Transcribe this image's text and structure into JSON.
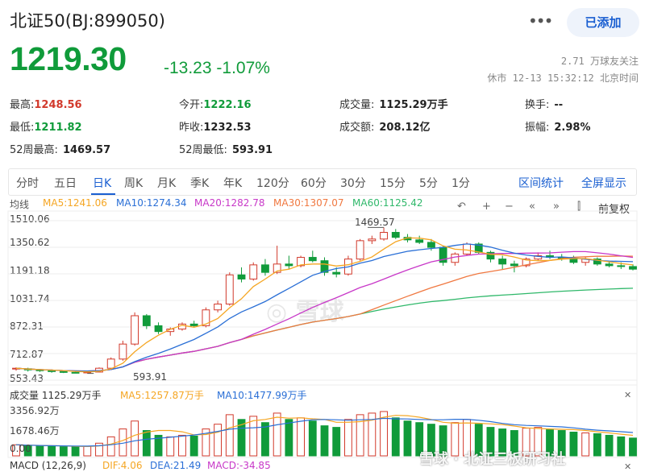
{
  "header": {
    "title": "北证50(BJ:899050)",
    "more_icon": "ellipsis-icon",
    "add_button": "已添加"
  },
  "quote": {
    "price": "1219.30",
    "change": "-13.23",
    "change_pct": "-1.07%",
    "followers": "2.71 万球友关注",
    "status": "休市 12-13 15:32:12 北京时间"
  },
  "stats": {
    "high_label": "最高:",
    "high": "1248.56",
    "low_label": "最低:",
    "low": "1211.82",
    "w52high_label": "52周最高:",
    "w52high": "1469.57",
    "open_label": "今开:",
    "open": "1222.16",
    "prevclose_label": "昨收:",
    "prevclose": "1232.53",
    "w52low_label": "52周最低:",
    "w52low": "593.91",
    "volume_label": "成交量:",
    "volume": "1125.29万手",
    "amount_label": "成交额:",
    "amount": "208.12亿",
    "turnover_label": "换手:",
    "turnover": "--",
    "amplitude_label": "振幅:",
    "amplitude": "2.98%"
  },
  "tabs": [
    "分时",
    "五日",
    "日K",
    "周K",
    "月K",
    "季K",
    "年K",
    "120分",
    "60分",
    "30分",
    "15分",
    "5分",
    "1分"
  ],
  "active_tab": "日K",
  "right_tabs": [
    "区间统计",
    "全屏显示"
  ],
  "ma_legend": {
    "label": "均线",
    "ma5": "MA5:1241.06",
    "ma10": "MA10:1274.34",
    "ma20": "MA20:1282.78",
    "ma30": "MA30:1307.07",
    "ma60": "MA60:1125.42"
  },
  "toolbar": {
    "icons": [
      "undo-icon",
      "zoom-in-icon",
      "zoom-out-icon",
      "scroll-left-icon",
      "scroll-right-icon",
      "candle-settings-icon"
    ],
    "adjust_label": "前复权"
  },
  "y_axis": [
    "1510.06",
    "1350.62",
    "1191.18",
    "1031.74",
    "872.31",
    "712.87",
    "553.43"
  ],
  "annotations": {
    "high_mark": "1469.57",
    "low_mark": "593.91"
  },
  "watermark": "雪球",
  "volume_panel": {
    "legend_label": "成交量 1125.29万手",
    "ma5": "MA5:1257.87万手",
    "ma10": "MA10:1477.99万手",
    "y_axis": [
      "3356.92万",
      "1678.46万",
      "0.00"
    ]
  },
  "macd_panel": {
    "label": "MACD (12,26,9)",
    "dif": "DIF:4.06",
    "dea": "DEA:21.49",
    "macd": "MACD:-34.85"
  },
  "footer_watermark": "雪球 · 北证三板研习社",
  "colors": {
    "up": "#d23a2c",
    "down": "#109b3a",
    "accent": "#1a5fd1",
    "ma5": "#f5a623",
    "ma10": "#2a6fd6",
    "ma20": "#c838c8",
    "ma30": "#f07840",
    "ma60": "#2fb86a"
  },
  "chart_data": {
    "type": "candlestick",
    "ylim": [
      553.43,
      1510.06
    ],
    "candles_ohlc": [
      [
        620,
        630,
        610,
        625
      ],
      [
        622,
        628,
        605,
        615
      ],
      [
        615,
        620,
        603,
        610
      ],
      [
        610,
        618,
        598,
        605
      ],
      [
        605,
        612,
        596,
        600
      ],
      [
        600,
        608,
        595,
        598
      ],
      [
        598,
        605,
        593.91,
        602
      ],
      [
        602,
        630,
        600,
        625
      ],
      [
        625,
        690,
        620,
        680
      ],
      [
        680,
        790,
        670,
        770
      ],
      [
        770,
        960,
        760,
        940
      ],
      [
        940,
        950,
        860,
        880
      ],
      [
        880,
        900,
        830,
        845
      ],
      [
        845,
        870,
        820,
        860
      ],
      [
        860,
        900,
        850,
        890
      ],
      [
        890,
        910,
        870,
        880
      ],
      [
        880,
        990,
        870,
        975
      ],
      [
        975,
        1030,
        960,
        1010
      ],
      [
        1010,
        1200,
        1000,
        1185
      ],
      [
        1185,
        1230,
        1140,
        1160
      ],
      [
        1160,
        1260,
        1150,
        1245
      ],
      [
        1245,
        1280,
        1180,
        1200
      ],
      [
        1200,
        1360,
        1190,
        1250
      ],
      [
        1250,
        1300,
        1220,
        1240
      ],
      [
        1240,
        1300,
        1230,
        1290
      ],
      [
        1290,
        1330,
        1260,
        1270
      ],
      [
        1270,
        1290,
        1180,
        1200
      ],
      [
        1200,
        1230,
        1170,
        1190
      ],
      [
        1190,
        1300,
        1180,
        1280
      ],
      [
        1280,
        1400,
        1270,
        1390
      ],
      [
        1390,
        1420,
        1370,
        1400
      ],
      [
        1400,
        1469.57,
        1390,
        1440
      ],
      [
        1440,
        1460,
        1400,
        1410
      ],
      [
        1410,
        1430,
        1380,
        1395
      ],
      [
        1395,
        1420,
        1370,
        1380
      ],
      [
        1380,
        1400,
        1330,
        1350
      ],
      [
        1350,
        1360,
        1240,
        1260
      ],
      [
        1260,
        1320,
        1240,
        1310
      ],
      [
        1310,
        1380,
        1300,
        1370
      ],
      [
        1370,
        1380,
        1310,
        1320
      ],
      [
        1320,
        1330,
        1260,
        1280
      ],
      [
        1280,
        1300,
        1220,
        1250
      ],
      [
        1250,
        1270,
        1200,
        1240
      ],
      [
        1240,
        1290,
        1230,
        1280
      ],
      [
        1280,
        1320,
        1270,
        1300
      ],
      [
        1300,
        1330,
        1280,
        1290
      ],
      [
        1290,
        1310,
        1270,
        1285
      ],
      [
        1285,
        1300,
        1250,
        1260
      ],
      [
        1260,
        1290,
        1240,
        1280
      ],
      [
        1280,
        1290,
        1240,
        1250
      ],
      [
        1250,
        1270,
        1230,
        1240
      ],
      [
        1240,
        1260,
        1220,
        1235
      ],
      [
        1235,
        1248.56,
        1211.82,
        1219.3
      ]
    ],
    "volume_wan": [
      700,
      650,
      620,
      600,
      580,
      560,
      600,
      800,
      1200,
      1700,
      2200,
      1600,
      1300,
      1200,
      1300,
      1250,
      1700,
      2000,
      2600,
      2300,
      2500,
      2100,
      2700,
      2300,
      2400,
      2200,
      1900,
      1800,
      2300,
      2600,
      2700,
      2800,
      2400,
      2200,
      2100,
      2000,
      1900,
      2100,
      2300,
      2000,
      1800,
      1700,
      1600,
      1750,
      1800,
      1650,
      1600,
      1500,
      1450,
      1400,
      1300,
      1200,
      1125.29
    ]
  }
}
